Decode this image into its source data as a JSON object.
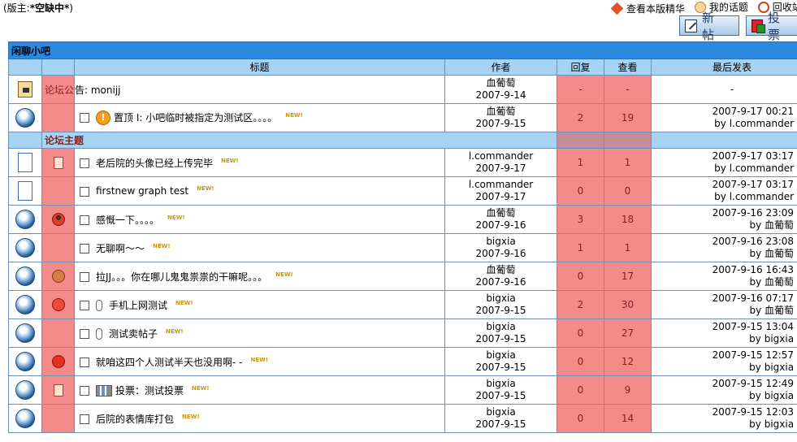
{
  "top": {
    "moderator_label": "(版主:",
    "moderator_name": "*空缺中*",
    "moderator_close": ")",
    "links": [
      {
        "label": "查看本版精华",
        "icon": "diamond-icon"
      },
      {
        "label": "我的话题",
        "icon": "user-icon"
      },
      {
        "label": "回收站",
        "icon": "forbidden-icon"
      }
    ]
  },
  "buttons": {
    "new_post": "新帖",
    "vote": "投票"
  },
  "forum": {
    "name": "闲聊小吧",
    "columns": [
      "标题",
      "作者",
      "回复",
      "查看",
      "最后发表"
    ],
    "section_label": "论坛主题",
    "announcement": {
      "prefix": "论坛公",
      "rest": "告: monijj",
      "author": "血葡萄",
      "date": "2007-9-14",
      "replies": "-",
      "views": "-",
      "last": "-"
    },
    "sticky": {
      "label": "置顶 I:",
      "title": "小吧临时被指定为测试区。。。。",
      "author": "血葡萄",
      "date": "2007-9-15",
      "replies": "2",
      "views": "19",
      "last_time": "2007-9-17 00:21",
      "last_by": "by l.commander",
      "new_badge": "NEW!"
    },
    "threads": [
      {
        "status_icon": "document-icon",
        "mood_icon": "memo-icon",
        "extra_icon": "",
        "title": "老后院的头像已经上传完毕",
        "author": "l.commander",
        "date": "2007-9-17",
        "replies": "1",
        "views": "1",
        "last_time": "2007-9-17 03:17",
        "last_by": "by l.commander",
        "new_badge": "NEW!"
      },
      {
        "status_icon": "document-icon",
        "mood_icon": "",
        "extra_icon": "",
        "title": "firstnew graph test",
        "author": "l.commander",
        "date": "2007-9-17",
        "replies": "0",
        "views": "0",
        "last_time": "2007-9-17 03:17",
        "last_by": "by l.commander",
        "new_badge": "NEW!"
      },
      {
        "status_icon": "globe-icon",
        "mood_icon": "cool-face-icon",
        "extra_icon": "",
        "title": "感慨一下。。。。",
        "author": "血葡萄",
        "date": "2007-9-16",
        "replies": "3",
        "views": "18",
        "last_time": "2007-9-16 23:09",
        "last_by": "by 血葡萄",
        "new_badge": "NEW!"
      },
      {
        "status_icon": "globe-icon",
        "mood_icon": "",
        "extra_icon": "",
        "title": "无聊啊～～",
        "author": "bigxia",
        "date": "2007-9-16",
        "replies": "1",
        "views": "1",
        "last_time": "2007-9-16 23:08",
        "last_by": "by 血葡萄",
        "new_badge": "NEW!"
      },
      {
        "status_icon": "globe-icon",
        "mood_icon": "tongue-face-icon",
        "extra_icon": "",
        "title": "拉JJ。。。你在哪儿鬼鬼祟祟的干嘛呢。。。",
        "author": "血葡萄",
        "date": "2007-9-16",
        "replies": "0",
        "views": "17",
        "last_time": "2007-9-16 16:43",
        "last_by": "by 血葡萄",
        "new_badge": "NEW!"
      },
      {
        "status_icon": "globe-icon",
        "mood_icon": "smile-face-icon",
        "extra_icon": "paperclip-icon",
        "title": "手机上网测试",
        "author": "bigxia",
        "date": "2007-9-15",
        "replies": "2",
        "views": "30",
        "last_time": "2007-9-16 07:17",
        "last_by": "by 血葡萄",
        "new_badge": "NEW!"
      },
      {
        "status_icon": "globe-icon",
        "mood_icon": "",
        "extra_icon": "paperclip-icon",
        "title": "测试卖帖子",
        "author": "bigxia",
        "date": "2007-9-15",
        "replies": "0",
        "views": "27",
        "last_time": "2007-9-15 13:04",
        "last_by": "by bigxia",
        "new_badge": "NEW!"
      },
      {
        "status_icon": "globe-icon",
        "mood_icon": "grin-face-icon",
        "extra_icon": "",
        "title": "就咱这四个人测试半天也没用啊- -",
        "author": "bigxia",
        "date": "2007-9-15",
        "replies": "0",
        "views": "12",
        "last_time": "2007-9-15 12:57",
        "last_by": "by bigxia",
        "new_badge": "NEW!"
      },
      {
        "status_icon": "globe-icon",
        "mood_icon": "memo-icon",
        "extra_icon": "poll-icon",
        "title": "投票：测试投票",
        "author": "bigxia",
        "date": "2007-9-15",
        "replies": "0",
        "views": "9",
        "last_time": "2007-9-15 12:49",
        "last_by": "by bigxia",
        "new_badge": "NEW!"
      },
      {
        "status_icon": "globe-icon",
        "mood_icon": "",
        "extra_icon": "",
        "title": "后院的表情库打包",
        "author": "bigxia",
        "date": "2007-9-15",
        "replies": "0",
        "views": "14",
        "last_time": "2007-9-15 12:03",
        "last_by": "by bigxia",
        "new_badge": "NEW!"
      }
    ]
  }
}
